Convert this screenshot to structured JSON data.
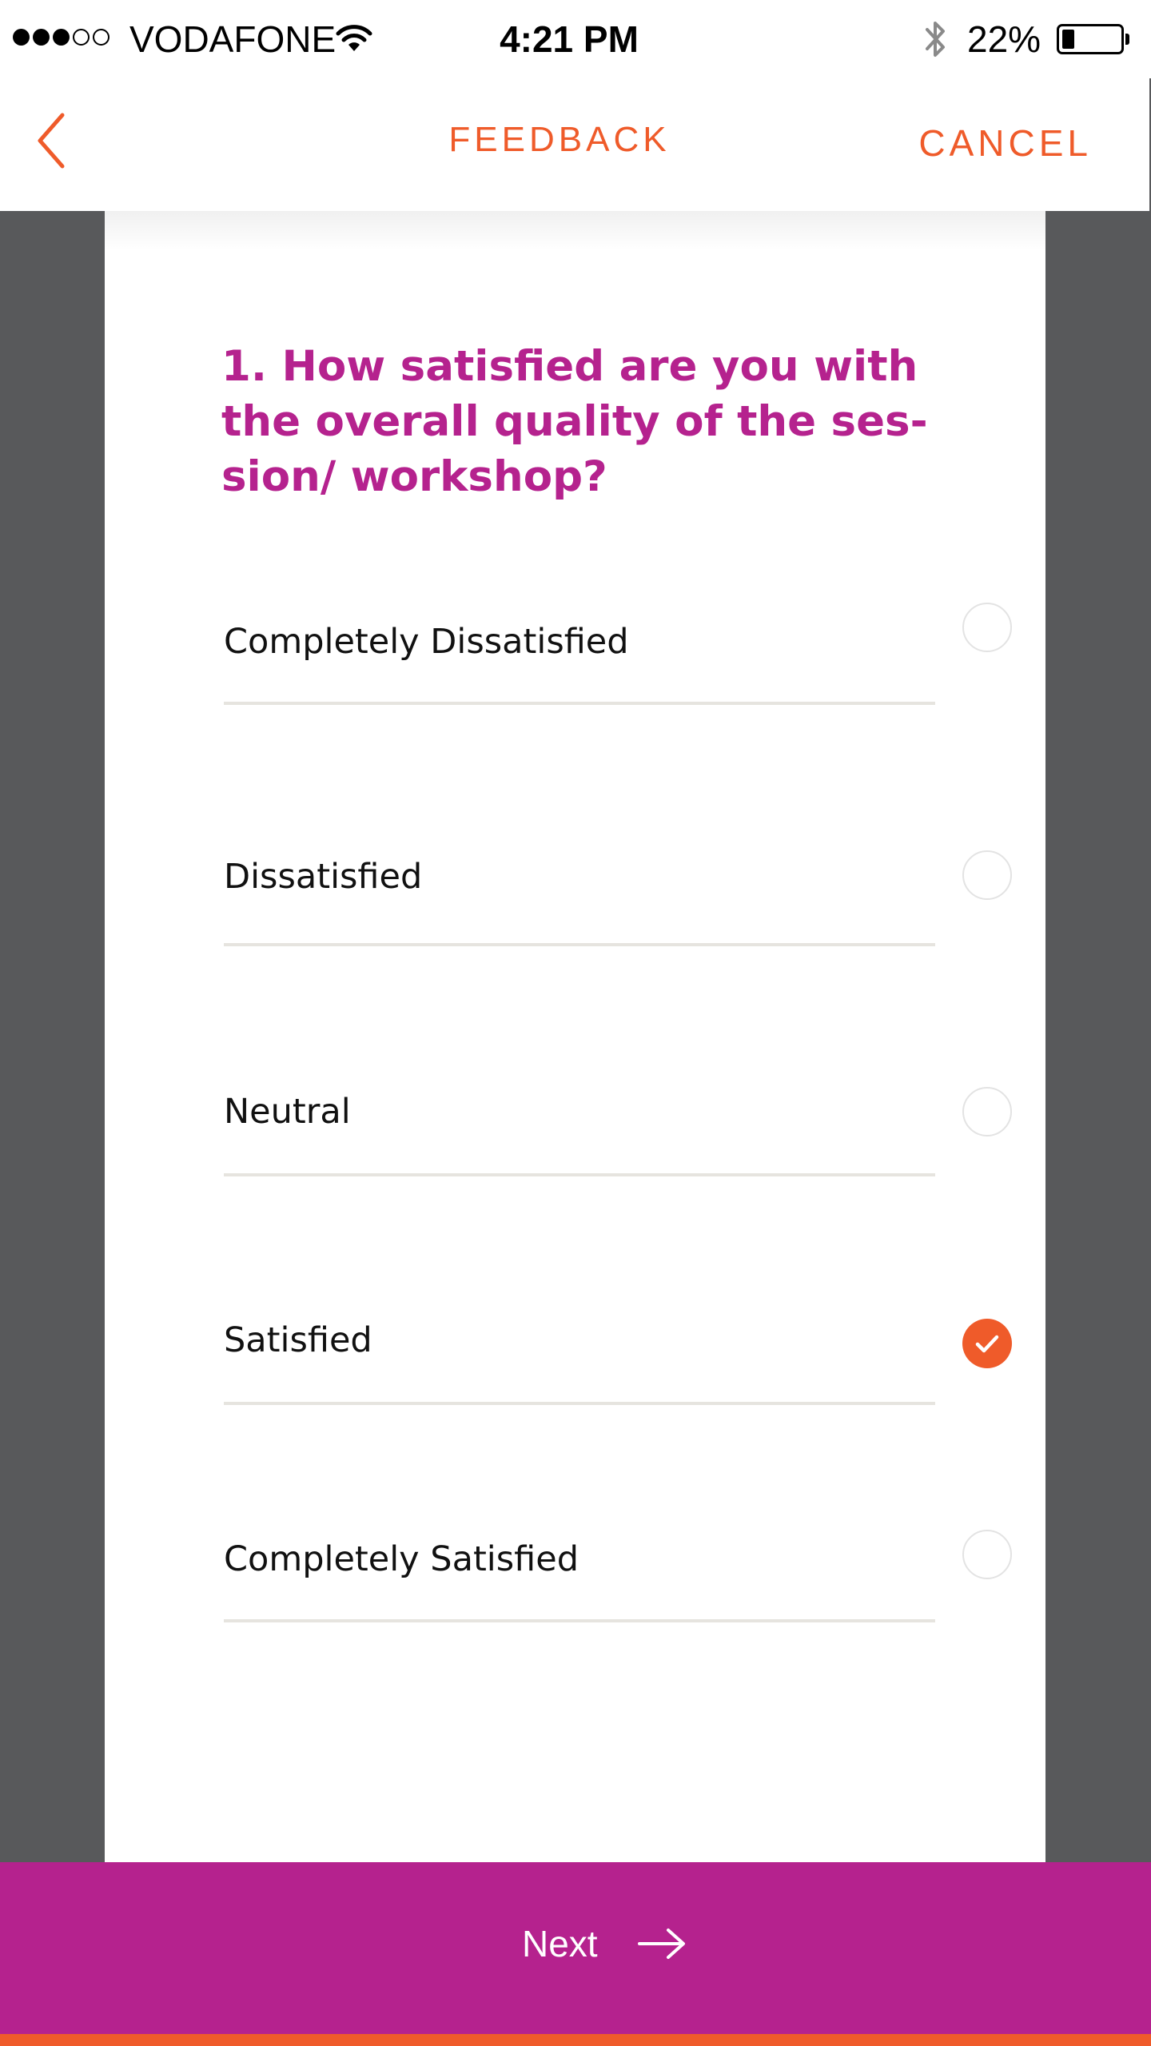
{
  "status_bar": {
    "carrier": "VODAFONE",
    "time": "4:21 PM",
    "battery_percent": "22%",
    "battery_level": 0.22,
    "signal_bars_filled": 3,
    "signal_bars_total": 5,
    "icons": [
      "signal-dots-icon",
      "wifi-icon",
      "bluetooth-icon",
      "battery-icon"
    ]
  },
  "nav": {
    "back_icon": "chevron-left-icon",
    "title": "FEEDBACK",
    "cancel_label": "CANCEL"
  },
  "question": {
    "text": "1. How satisfied are you with the overall quality of the ses-sion/ workshop?",
    "lines": [
      "1. How satisfied are you with",
      "the overall quality of the ses-",
      "sion/ workshop?"
    ]
  },
  "options": [
    {
      "label": "Completely Dissatisfied",
      "selected": false
    },
    {
      "label": "Dissatisfied",
      "selected": false
    },
    {
      "label": "Neutral",
      "selected": false
    },
    {
      "label": "Satisfied",
      "selected": true
    },
    {
      "label": "Completely Satisfied",
      "selected": false
    }
  ],
  "footer": {
    "next_label": "Next",
    "next_icon": "arrow-right-icon"
  },
  "colors": {
    "accent_orange": "#ef5b2a",
    "brand_magenta": "#b5228e",
    "backdrop_gray": "#58595b",
    "divider": "#e6e4df"
  }
}
